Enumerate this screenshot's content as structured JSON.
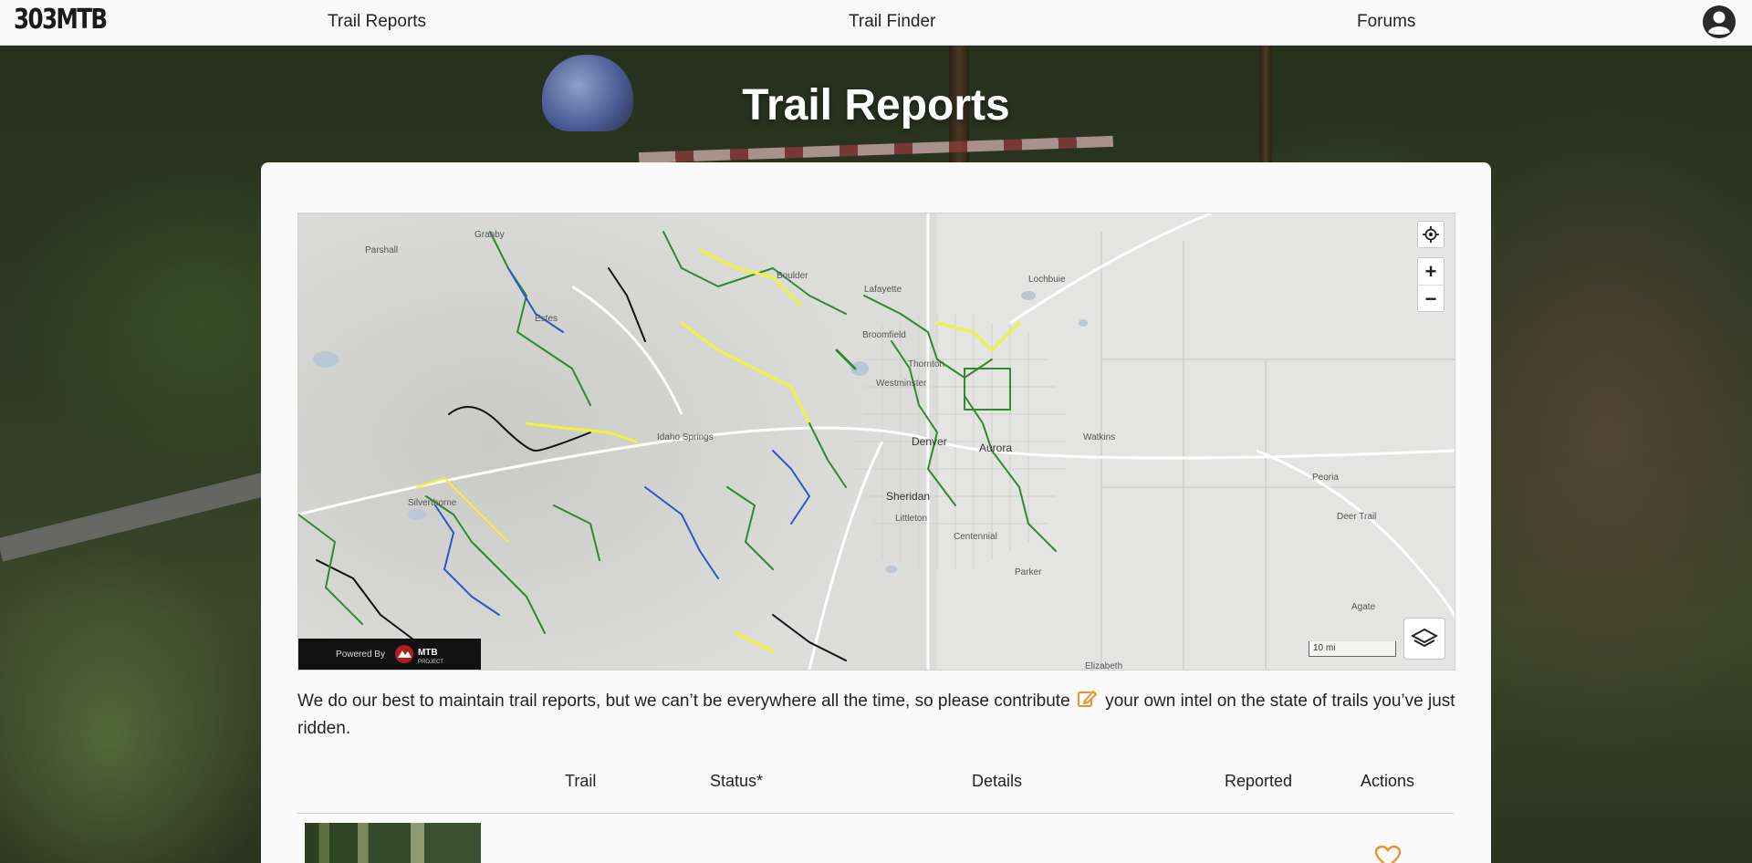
{
  "header": {
    "logo": "303MTB",
    "nav": [
      "Trail Reports",
      "Trail Finder",
      "Forums"
    ],
    "account_icon": "account-circle-icon"
  },
  "page": {
    "title": "Trail Reports"
  },
  "map": {
    "place_labels": [
      "Parshall",
      "Granby",
      "Boulder",
      "Lafayette",
      "Lochbuie",
      "Broomfield",
      "Thornton",
      "Westminster",
      "Idaho Springs",
      "Denver",
      "Aurora",
      "Watkins",
      "Peoria",
      "Silverthorne",
      "Sheridan",
      "Littleton",
      "Centennial",
      "Deer Trail",
      "Parker",
      "Agate",
      "Elizabeth",
      "Estes"
    ],
    "scale_label": "10 mi",
    "powered_by": "Powered By",
    "mtb_project": "MTB",
    "mtb_project_sub": "PROJECT",
    "locate_icon": "locate-target-icon",
    "zoom_in": "+",
    "zoom_out": "−",
    "layers_icon": "layers-icon"
  },
  "description": {
    "before": "We do our best to maintain trail reports, but we can’t be everywhere all the time, so please contribute ",
    "after": " your own intel on the state of trails you’ve just ridden.",
    "edit_icon": "edit-pencil-icon"
  },
  "table": {
    "columns": [
      "Trail",
      "Status*",
      "Details",
      "Reported",
      "Actions"
    ],
    "row_action_icon": "heart-outline-icon"
  },
  "colors": {
    "accent": "#e8942a",
    "trail_green": "#2e8b2e",
    "trail_blue": "#2a58c8",
    "trail_yellow": "#f2f23a",
    "trail_black": "#111111"
  }
}
